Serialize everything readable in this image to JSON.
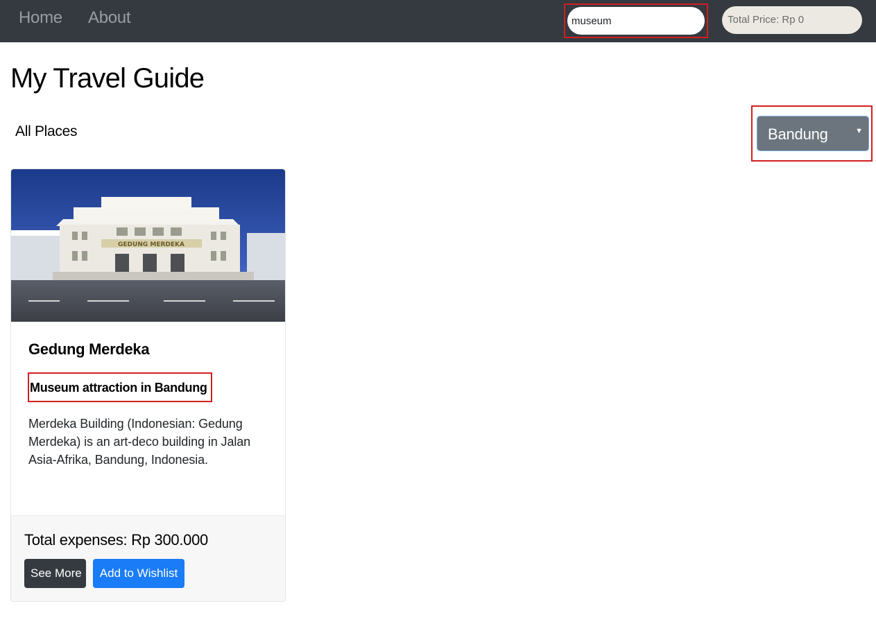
{
  "nav": {
    "items": [
      {
        "label": "Home"
      },
      {
        "label": "About"
      }
    ],
    "search": {
      "value": "museum"
    },
    "total_price": "Total Price: Rp 0"
  },
  "page": {
    "title": "My Travel Guide",
    "section_label": "All Places"
  },
  "city_select": {
    "selected": "Bandung"
  },
  "cards": [
    {
      "title": "Gedung Merdeka",
      "subtitle": "Museum attraction in Bandung",
      "description": "Merdeka Building (Indonesian: Gedung Merdeka) is an art-deco building in Jalan Asia-Afrika, Bandung, Indonesia.",
      "image_lettering": "GEDUNG MERDEKA",
      "expenses": "Total expenses: Rp 300.000",
      "buttons": {
        "see_more": "See More",
        "wishlist": "Add to Wishlist"
      }
    }
  ],
  "colors": {
    "navbar": "#343a40",
    "primary": "#1a7cf6",
    "highlight_border": "#d11f1f",
    "select_bg": "#6c757d"
  }
}
